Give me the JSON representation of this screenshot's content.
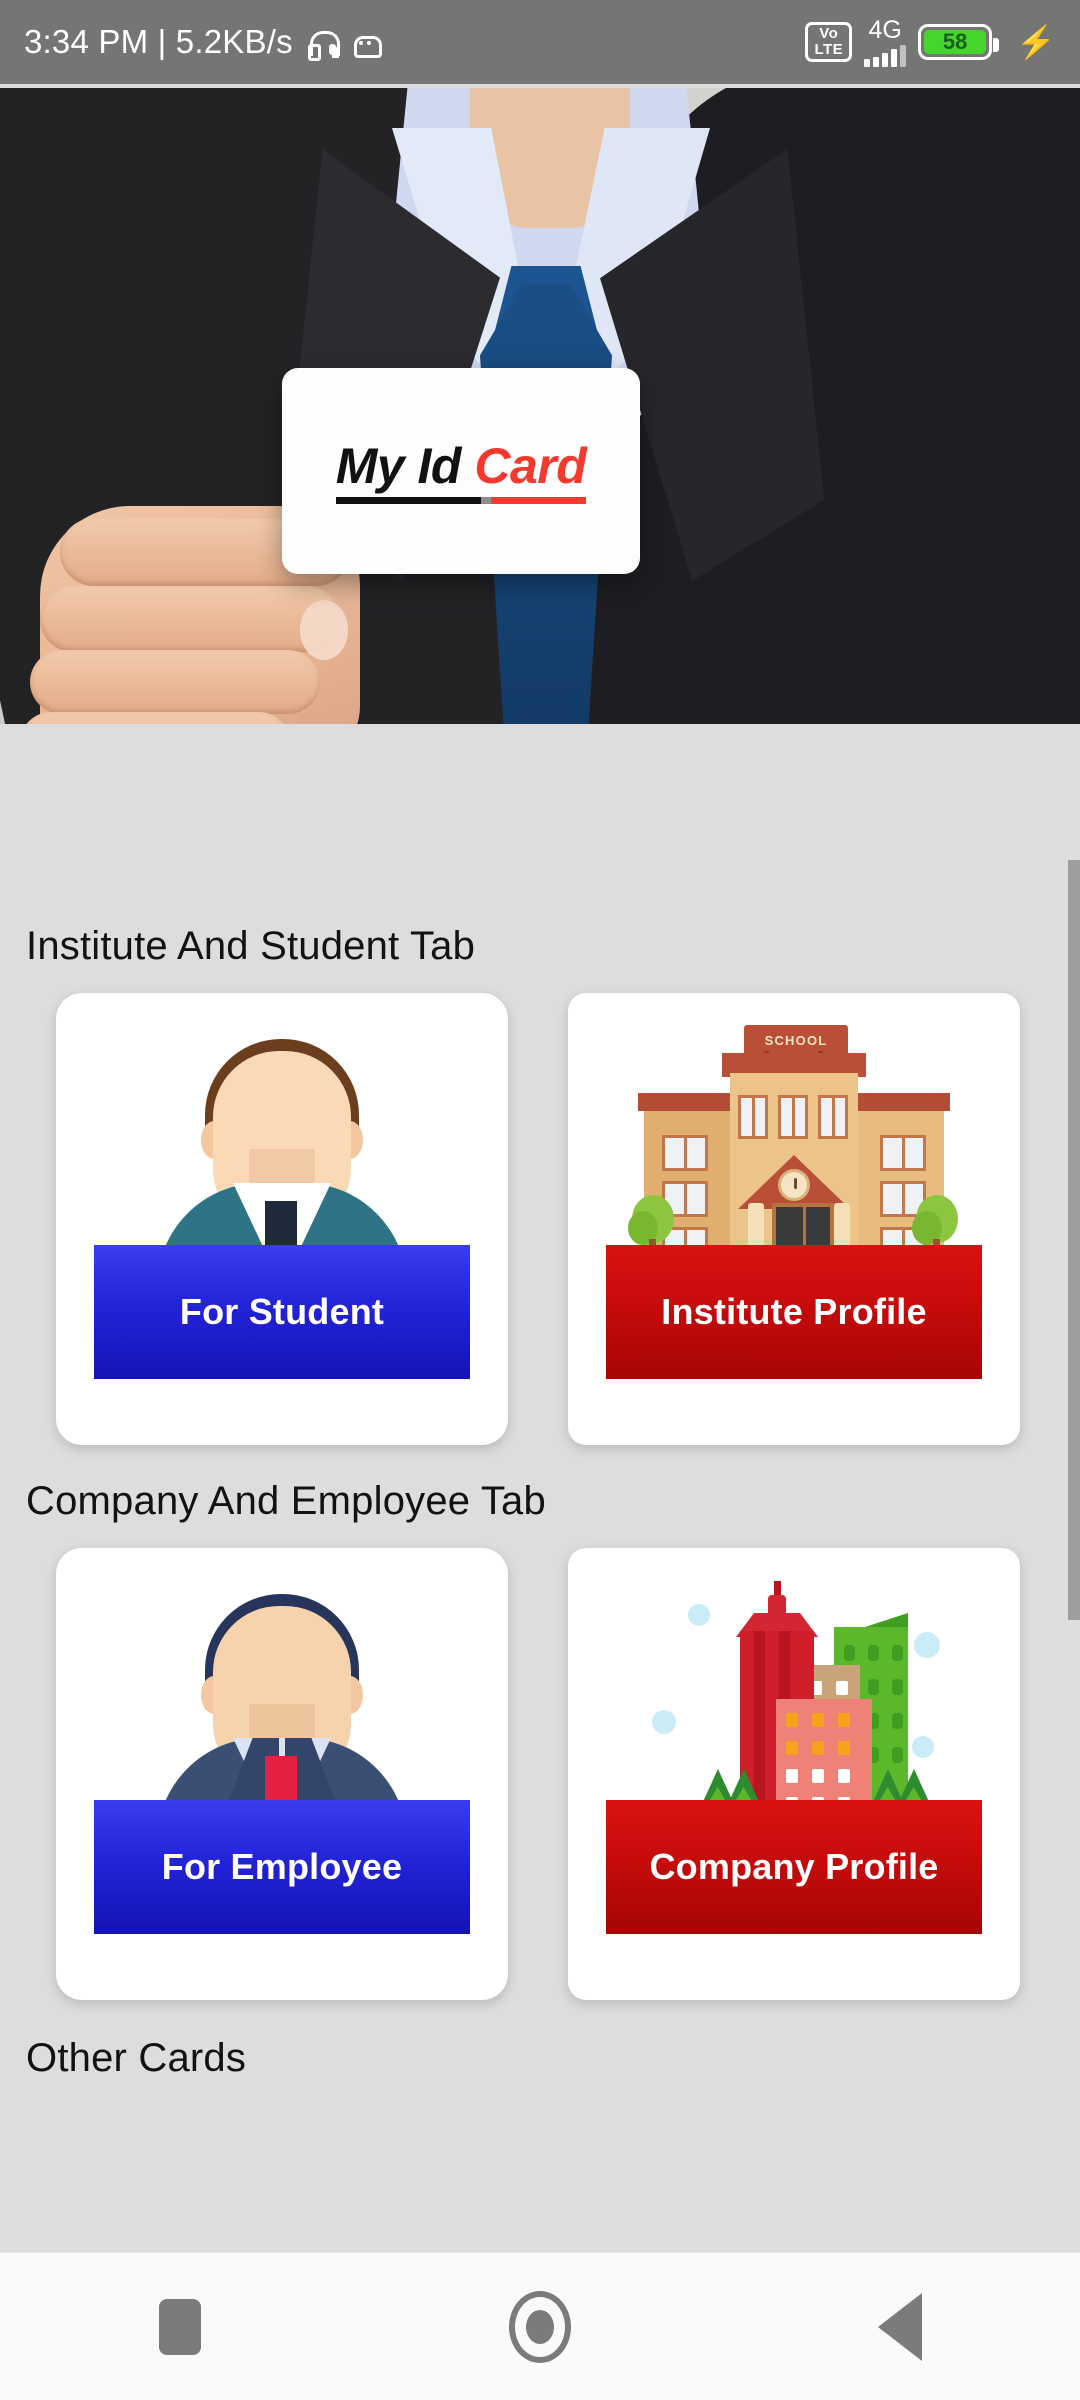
{
  "status_bar": {
    "clock": "3:34 PM | 5.2KB/s",
    "headset_icon": "headset-icon",
    "android_icon": "android-robot-icon",
    "volte_label_top": "Vo",
    "volte_label_bottom": "LTE",
    "network_label": "4G",
    "signal_icon": "signal-bars-icon",
    "battery_level": "58",
    "charging_icon": "⚡",
    "battery_color": "#44d62c"
  },
  "banner": {
    "name": "hero-banner-businessman-holding-id-card",
    "card_text_black": "My Id",
    "card_text_red": "Card",
    "accent_red": "#f4392f",
    "accent_black": "#111111",
    "tie_color": "#17477a",
    "suit_color": "#232326"
  },
  "sections": [
    {
      "title": "Institute And Student Tab",
      "tiles": [
        {
          "art": "student-avatar-icon",
          "button_label": "For Student",
          "button_color": "#2323d8",
          "button_style": "blue"
        },
        {
          "art": "school-building-icon",
          "sign_label": "SCHOOL",
          "button_label": "Institute Profile",
          "button_color": "#c60b0b",
          "button_style": "red"
        }
      ]
    },
    {
      "title": "Company And Employee Tab",
      "tiles": [
        {
          "art": "employee-avatar-icon",
          "button_label": "For Employee",
          "button_color": "#2323d8",
          "button_style": "blue"
        },
        {
          "art": "company-buildings-icon",
          "button_label": "Company Profile",
          "button_color": "#c60b0b",
          "button_style": "red"
        }
      ]
    },
    {
      "title": "Other Cards",
      "tiles": []
    }
  ],
  "nav_bar": {
    "recents_icon": "square-recents-icon",
    "home_icon": "circle-home-icon",
    "back_icon": "triangle-back-icon"
  },
  "theme": {
    "page_background": "#dddddd",
    "card_background": "#ffffff",
    "status_bar_background": "#757575",
    "scrollbar_color": "#9e9e9e"
  }
}
